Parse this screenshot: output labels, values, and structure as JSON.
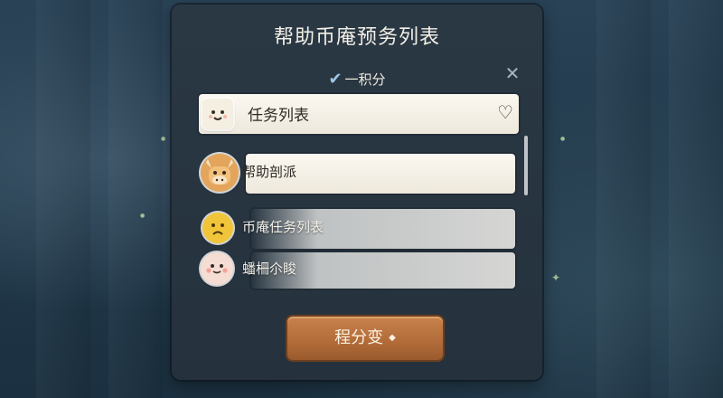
{
  "panel": {
    "title": "帮助币庵预务列表",
    "points_label": "一积分",
    "check_icon": "checkmark-icon",
    "close_icon": "close-icon"
  },
  "rows": [
    {
      "label": "任务列表",
      "avatar": "tofu-face-icon",
      "selected": true,
      "favorite_icon": "heart-outline-icon"
    },
    {
      "label": "帮助剖派",
      "avatar": "cow-face-icon"
    },
    {
      "label": "币庵任务列表",
      "avatar": "sad-yellow-face-icon"
    },
    {
      "label": "蟠柵尒睃",
      "avatar": "pink-blush-face-icon"
    }
  ],
  "action_button": {
    "label": "程分变",
    "icon": "diamond-icon"
  },
  "colors": {
    "panel": "#25323d",
    "button": "#b36d3a",
    "row_selected": "#fbf8f1"
  }
}
